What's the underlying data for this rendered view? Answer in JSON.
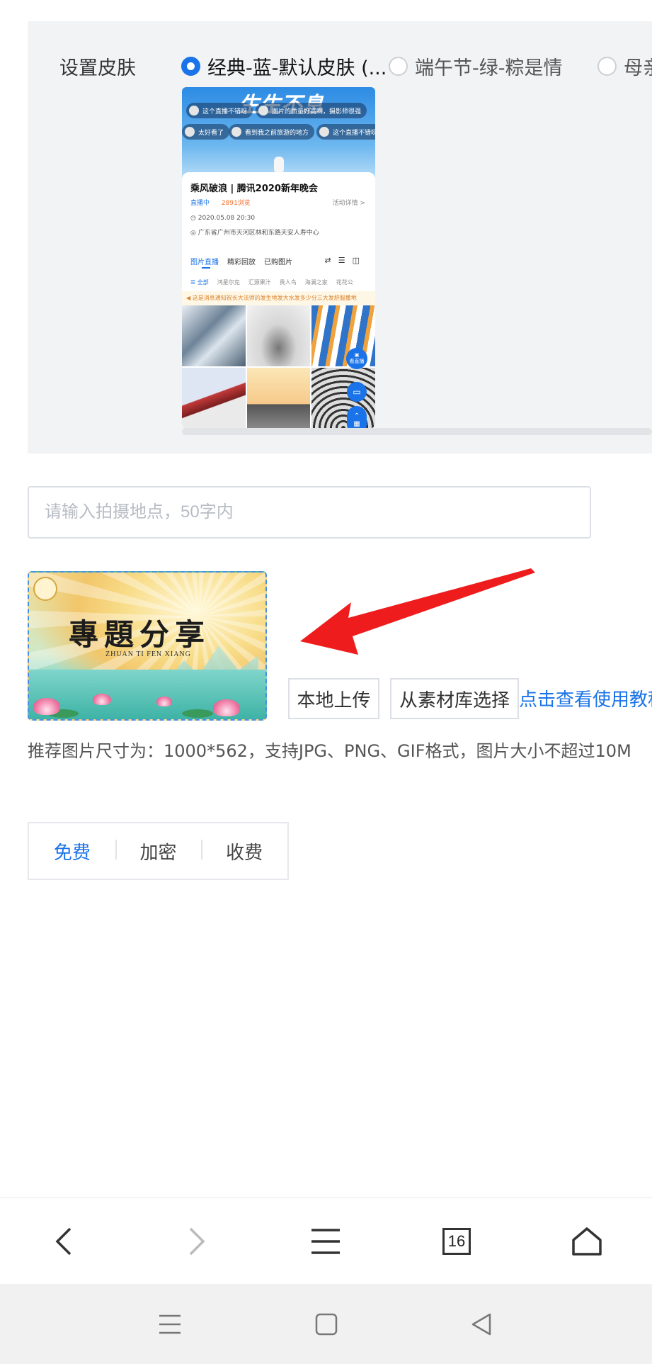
{
  "skin": {
    "label": "设置皮肤",
    "options": [
      {
        "label": "经典-蓝-默认皮肤 (...",
        "selected": true
      },
      {
        "label": "端午节-绿-粽是情",
        "selected": false
      },
      {
        "label": "母亲",
        "selected": false
      }
    ],
    "preview": {
      "hero_title": "生生不息",
      "danmaku": [
        "这个直播不错呀",
        "图片的质量好高啊，摄影师很强",
        "太好看了",
        "看到我之前旅游的地方",
        "这个直播不错呀"
      ],
      "event_title": "乘风破浪 | 腾讯2020新年晚会",
      "status": "直播中",
      "views": "2891浏览",
      "detail_link": "活动详情 >",
      "datetime": "2020.05.08 20:30",
      "address": "广东省广州市天河区林和东路天安人寿中心",
      "tabs": [
        "图片直播",
        "精彩回放",
        "已购图片"
      ],
      "categories": [
        "全部",
        "鸿星尔克",
        "汇源果汁",
        "贵人鸟",
        "海澜之家",
        "花花公"
      ],
      "notice": "这是消息通知祝长大法师的发生地发大水发多少分三大发舒服撒地",
      "fab_label": "看直播"
    }
  },
  "location": {
    "placeholder": "请输入拍摄地点，50字内",
    "value": ""
  },
  "cover": {
    "title": "專題分享",
    "subtitle": "ZHUAN TI FEN XIANG"
  },
  "upload": {
    "local_label": "本地上传",
    "library_label": "从素材库选择",
    "tutorial_link": "点击查看使用教程",
    "hint": "推荐图片尺寸为：1000*562，支持JPG、PNG、GIF格式，图片大小不超过10M"
  },
  "fee": {
    "tabs": [
      "免费",
      "加密",
      "收费"
    ],
    "active": "免费"
  },
  "browser": {
    "tab_count": "16"
  },
  "colors": {
    "accent": "#1a73e8",
    "annotation_arrow": "#ee1c1c"
  }
}
